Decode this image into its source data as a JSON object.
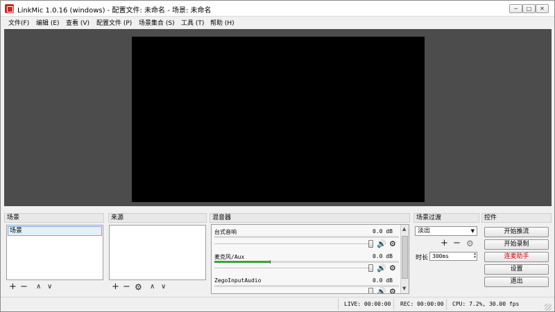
{
  "window": {
    "title": "LinkMic 1.0.16 (windows) - 配置文件: 未命名 - 场景: 未命名",
    "min_label": "─",
    "max_label": "□",
    "close_label": "✕"
  },
  "menu": [
    "文件(F)",
    "编辑 (E)",
    "查看 (V)",
    "配置文件 (P)",
    "场景集合 (S)",
    "工具 (T)",
    "帮助 (H)"
  ],
  "docks": {
    "scenes_title": "场景",
    "sources_title": "来源",
    "mixer_title": "混音器",
    "transitions_title": "场景过渡",
    "controls_title": "控件"
  },
  "scenes": {
    "items": [
      "场景"
    ]
  },
  "mixer": {
    "tracks": [
      {
        "name": "台式音响",
        "db": "0.0 dB",
        "level": 0
      },
      {
        "name": "麦克风/Aux",
        "db": "0.0 dB",
        "level": 0.3
      },
      {
        "name": "ZegoInputAudio",
        "db": "0.0 dB",
        "level": 0
      }
    ]
  },
  "transitions": {
    "selected": "淡出",
    "duration_label": "时长",
    "duration_value": "300ms"
  },
  "controls": {
    "buttons": [
      "开始推流",
      "开始录制",
      "连麦助手",
      "设置",
      "退出"
    ],
    "accent_button_color": "#d40000"
  },
  "status": {
    "live": "LIVE: 00:00:00",
    "rec": "REC: 00:00:00",
    "cpu": "CPU: 7.2%, 30.00 fps"
  },
  "icons": {
    "add": "+",
    "remove": "−",
    "up": "∧",
    "down": "∨",
    "gear": "⚙",
    "volume": "🔊"
  }
}
